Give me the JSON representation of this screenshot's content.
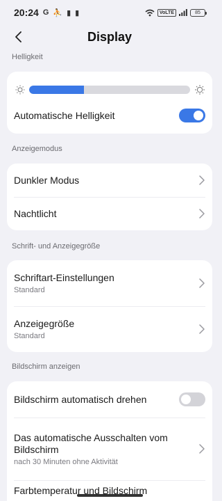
{
  "status": {
    "time": "20:24",
    "left_icons": [
      "G",
      "⛹",
      "▮",
      "▮"
    ],
    "volte": "VoLTE",
    "battery": "85"
  },
  "header": {
    "title": "Display"
  },
  "brightness": {
    "section_label": "Helligkeit",
    "level": 0.34,
    "auto_label": "Automatische Helligkeit",
    "auto_on": true
  },
  "display_mode": {
    "section_label": "Anzeigemodus",
    "dark_mode": "Dunkler Modus",
    "night_light": "Nachtlicht"
  },
  "font_size": {
    "section_label": "Schrift- und Anzeigegröße",
    "font_settings": "Schriftart-Einstellungen",
    "font_settings_value": "Standard",
    "display_size": "Anzeigegröße",
    "display_size_value": "Standard"
  },
  "screen": {
    "section_label": "Bildschirm anzeigen",
    "auto_rotate": "Bildschirm automatisch drehen",
    "auto_rotate_on": false,
    "screen_timeout": "Das automatische Ausschalten vom Bildschirm",
    "screen_timeout_value": "nach 30 Minuten ohne Aktivität",
    "cut_off": "Farbtemperatur und Bildschirm"
  },
  "colors": {
    "accent": "#3a78e6",
    "toggle_off": "#d3d3d8"
  }
}
